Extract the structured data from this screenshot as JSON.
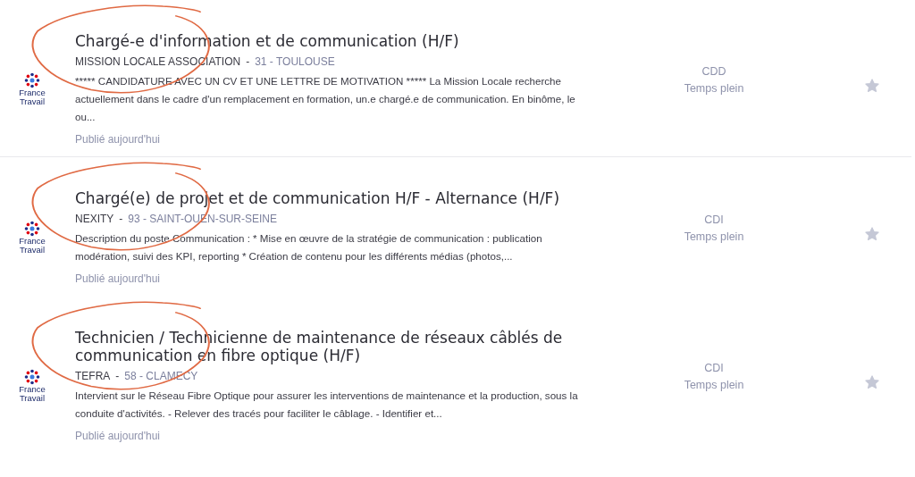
{
  "offers": [
    {
      "source": {
        "line1": "France",
        "line2": "Travail"
      },
      "title": "Chargé-e d'information et de communication (H/F)",
      "company": "MISSION LOCALE ASSOCIATION",
      "separator": "-",
      "location": "31 - TOULOUSE",
      "description": "***** CANDIDATURE AVEC UN CV ET UNE LETTRE DE MOTIVATION ***** La Mission Locale recherche actuellement dans le cadre d'un remplacement en formation, un.e chargé.e de communication. En binôme, le ou...",
      "published": "Publié aujourd'hui",
      "contract": "CDD",
      "schedule": "Temps plein",
      "favorite": false,
      "annotated": true,
      "divider": true
    },
    {
      "source": {
        "line1": "France",
        "line2": "Travail"
      },
      "title": "Chargé(e) de projet et de communication H/F - Alternance (H/F)",
      "company": "NEXITY",
      "separator": "-",
      "location": "93 - SAINT-OUEN-SUR-SEINE",
      "description": "Description du poste Communication : * Mise en œuvre de la stratégie de communication : publication modération, suivi des KPI, reporting * Création de contenu pour les différents médias (photos,...",
      "published": "Publié aujourd'hui",
      "contract": "CDI",
      "schedule": "Temps plein",
      "favorite": false,
      "annotated": true,
      "divider": false
    },
    {
      "source": {
        "line1": "France",
        "line2": "Travail"
      },
      "title": "Technicien / Technicienne de maintenance de réseaux câblés de communication en fibre optique (H/F)",
      "company": "TEFRA",
      "separator": "-",
      "location": "58 - CLAMECY",
      "description": "Intervient sur le Réseau Fibre Optique pour assurer les interventions de maintenance et la production, sous la conduite d'activités. - Relever des tracés pour faciliter le câblage. - Identifier et...",
      "published": "Publié aujourd'hui",
      "contract": "CDI",
      "schedule": "Temps plein",
      "favorite": false,
      "annotated": true,
      "divider": false
    }
  ]
}
